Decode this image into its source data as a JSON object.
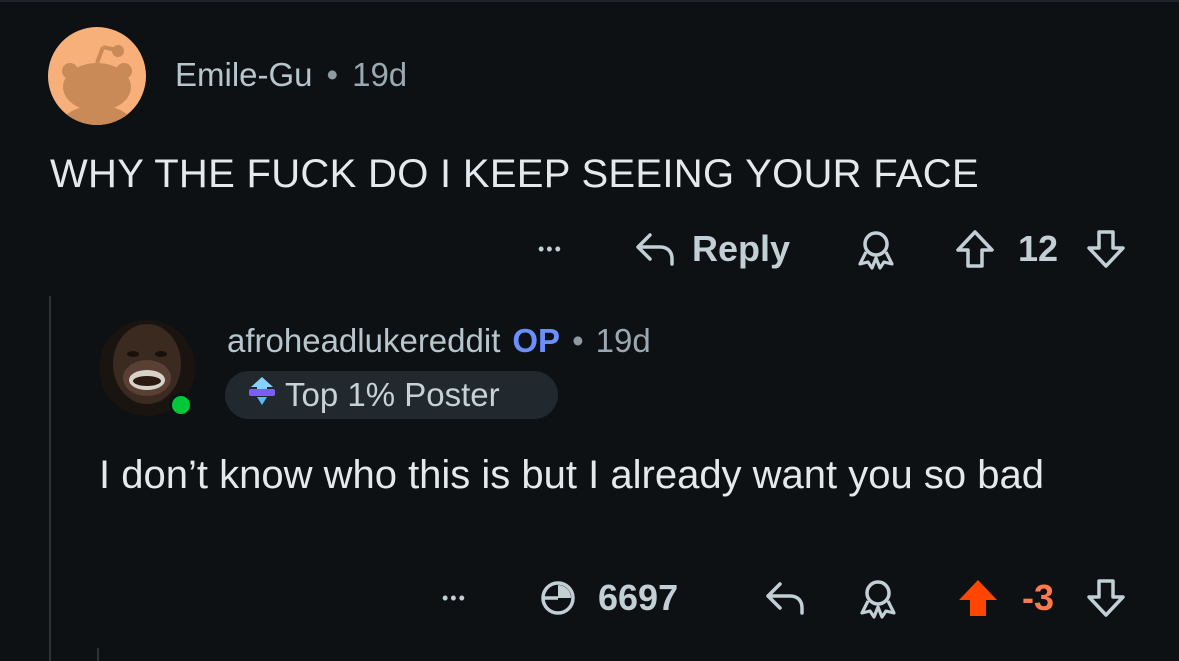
{
  "comments": [
    {
      "username": "Emile-Gu",
      "separator": "•",
      "time": "19d",
      "body": "WHY THE FUCK DO I KEEP SEEING YOUR FACE",
      "actions": {
        "more": "•••",
        "reply_label": "Reply",
        "vote_count": "12"
      },
      "icons": [
        "more-icon",
        "reply-icon",
        "award-icon",
        "upvote-icon",
        "downvote-icon"
      ]
    },
    {
      "username": "afroheadlukereddit",
      "op_badge": "OP",
      "separator": "•",
      "time": "19d",
      "flair": "Top 1% Poster",
      "online": true,
      "body": "I don’t know who this is but I already want you so bad",
      "actions": {
        "more": "•••",
        "views": "6697",
        "vote_count": "-3"
      },
      "icons": [
        "more-icon",
        "views-icon",
        "reply-icon",
        "award-icon",
        "upvote-icon",
        "downvote-icon"
      ]
    }
  ],
  "colors": {
    "background": "#0e1113",
    "op": "#6b8fff",
    "upvoted": "#ff4500",
    "negative_score": "#ff7a4d",
    "online": "#00c83a",
    "avatar1_bg": "#f7b07a"
  }
}
